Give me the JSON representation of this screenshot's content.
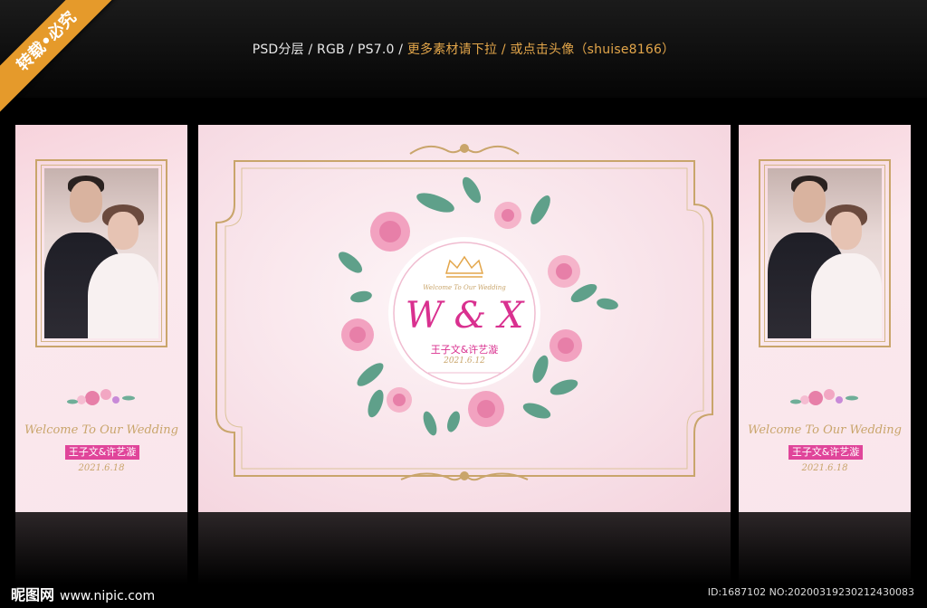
{
  "banner": {
    "main": "PSD分层 / RGB / PS7.0 / ",
    "accent": "更多素材请下拉 / 或点击头像（shuise8166）"
  },
  "ribbon": "转载•必究",
  "side": {
    "welcome": "Welcome To Our Wedding",
    "names": "王子文&许艺漩",
    "date": "2021.6.18"
  },
  "main": {
    "welcome": "Welcome To Our Wedding",
    "monogram": "W & X",
    "names": "王子文&许艺漩",
    "date": "2021.6.12"
  },
  "footer": {
    "logo": "昵图网",
    "site": "www.nipic.com",
    "id": "ID:1687102 NO:20200319230212430083"
  },
  "colors": {
    "gold": "#c9a56b",
    "magenta": "#d9308f",
    "badge": "#e0459a",
    "ribbon": "#e59a2b"
  }
}
